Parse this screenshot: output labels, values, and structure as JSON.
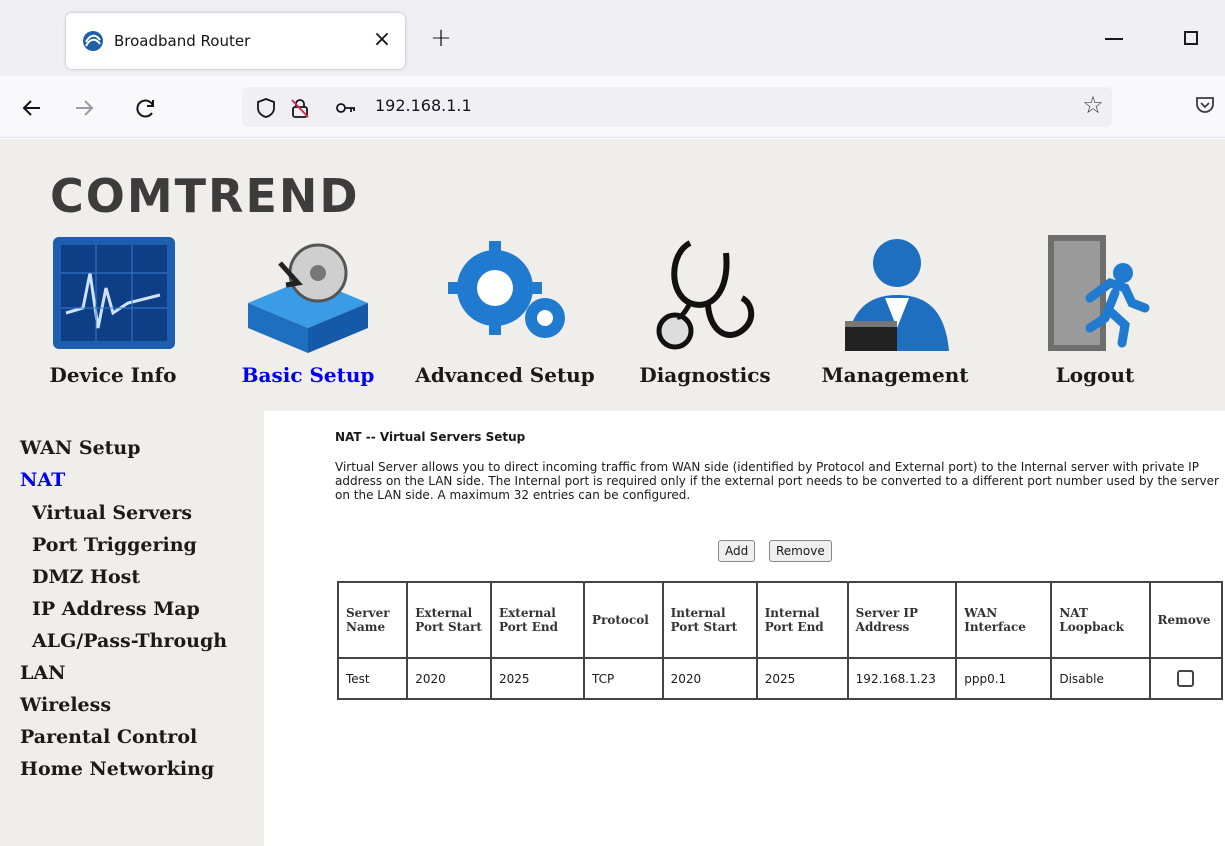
{
  "browser": {
    "tab_title": "Broadband Router",
    "tab_close": "×",
    "new_tab": "+",
    "url": "192.168.1.1",
    "icons": [
      "favicon-icon",
      "back-arrow-icon",
      "forward-arrow-icon",
      "reload-icon",
      "shield-icon",
      "insecure-lock-icon",
      "key-icon",
      "bookmark-star-icon",
      "pocket-icon",
      "minimize-icon",
      "maximize-icon"
    ]
  },
  "header": {
    "logo": "COMTREND",
    "nav": [
      {
        "label": "Device Info",
        "icon": "device-info-monitor-icon"
      },
      {
        "label": "Basic Setup",
        "icon": "basic-setup-box-icon",
        "active": true
      },
      {
        "label": "Advanced Setup",
        "icon": "advanced-setup-gears-icon"
      },
      {
        "label": "Diagnostics",
        "icon": "diagnostics-stethoscope-icon"
      },
      {
        "label": "Management",
        "icon": "management-person-icon"
      },
      {
        "label": "Logout",
        "icon": "logout-exit-icon"
      }
    ]
  },
  "sidebar": {
    "items": [
      {
        "label": "WAN Setup"
      },
      {
        "label": "NAT",
        "active": true
      },
      {
        "label": "Virtual Servers",
        "sub": true
      },
      {
        "label": "Port Triggering",
        "sub": true
      },
      {
        "label": "DMZ Host",
        "sub": true
      },
      {
        "label": "IP Address Map",
        "sub": true
      },
      {
        "label": "ALG/Pass-Through",
        "sub": true
      },
      {
        "label": "LAN"
      },
      {
        "label": "Wireless"
      },
      {
        "label": "Parental Control"
      },
      {
        "label": "Home Networking"
      }
    ]
  },
  "main": {
    "title": "NAT -- Virtual Servers Setup",
    "description": "Virtual Server allows you to direct incoming traffic from WAN side (identified by Protocol and External port) to the Internal server with private IP address on the LAN side. The Internal port is required only if the external port needs to be converted to a different port number used by the server on the LAN side. A maximum 32 entries can be configured.",
    "add_label": "Add",
    "remove_label": "Remove",
    "table": {
      "columns": [
        "Server Name",
        "External Port Start",
        "External Port End",
        "Protocol",
        "Internal Port Start",
        "Internal Port End",
        "Server IP Address",
        "WAN Interface",
        "NAT Loopback",
        "Remove"
      ],
      "rows": [
        {
          "server_name": "Test",
          "ext_start": "2020",
          "ext_end": "2025",
          "protocol": "TCP",
          "int_start": "2020",
          "int_end": "2025",
          "server_ip": "192.168.1.23",
          "wan_interface": "ppp0.1",
          "nat_loopback": "Disable",
          "remove_checked": false
        }
      ]
    }
  },
  "colors": {
    "active_link": "#0000ee",
    "header_bg": "#efeeea",
    "icon_blue": "#1f7ad0"
  }
}
